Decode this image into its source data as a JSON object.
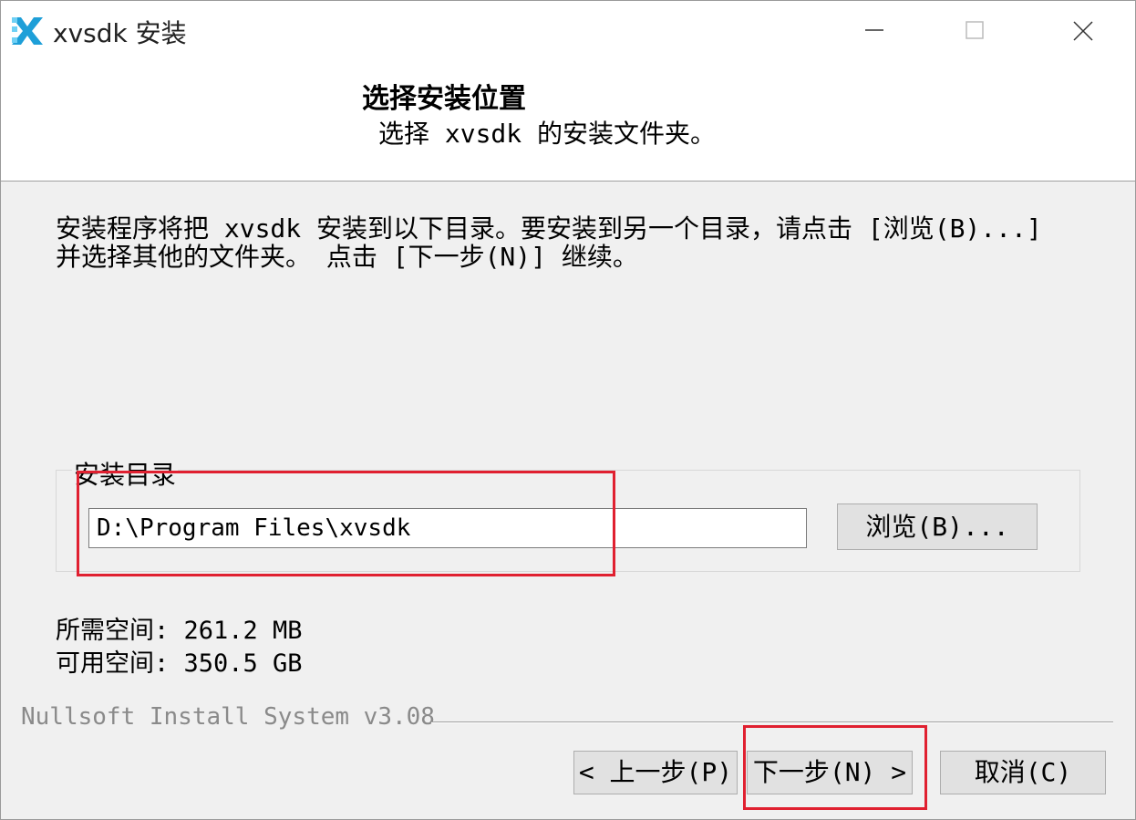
{
  "window": {
    "title": "xvsdk 安装",
    "icons": {
      "app": "xvsdk-logo-icon",
      "minimize": "minimize-icon",
      "maximize": "maximize-icon",
      "close": "close-icon"
    }
  },
  "header": {
    "title": "选择安装位置",
    "subtitle": "选择 xvsdk 的安装文件夹。"
  },
  "body": {
    "instruction_line1": "安装程序将把 xvsdk 安装到以下目录。要安装到另一个目录，请点击 [浏览(B)...]",
    "instruction_line2": "并选择其他的文件夹。 点击 [下一步(N)] 继续。"
  },
  "install_dir": {
    "group_label": "安装目录",
    "value": "D:\\Program Files\\xvsdk",
    "browse_label": "浏览(B)..."
  },
  "space": {
    "required": "所需空间: 261.2 MB",
    "available": "可用空间: 350.5 GB"
  },
  "branding": "Nullsoft Install System v3.08",
  "buttons": {
    "back": "< 上一步(P)",
    "next": "下一步(N) >",
    "cancel": "取消(C)"
  },
  "colors": {
    "accent": "#1e9fd8",
    "highlight": "#e02030",
    "dialog_bg": "#f0f0f0"
  }
}
